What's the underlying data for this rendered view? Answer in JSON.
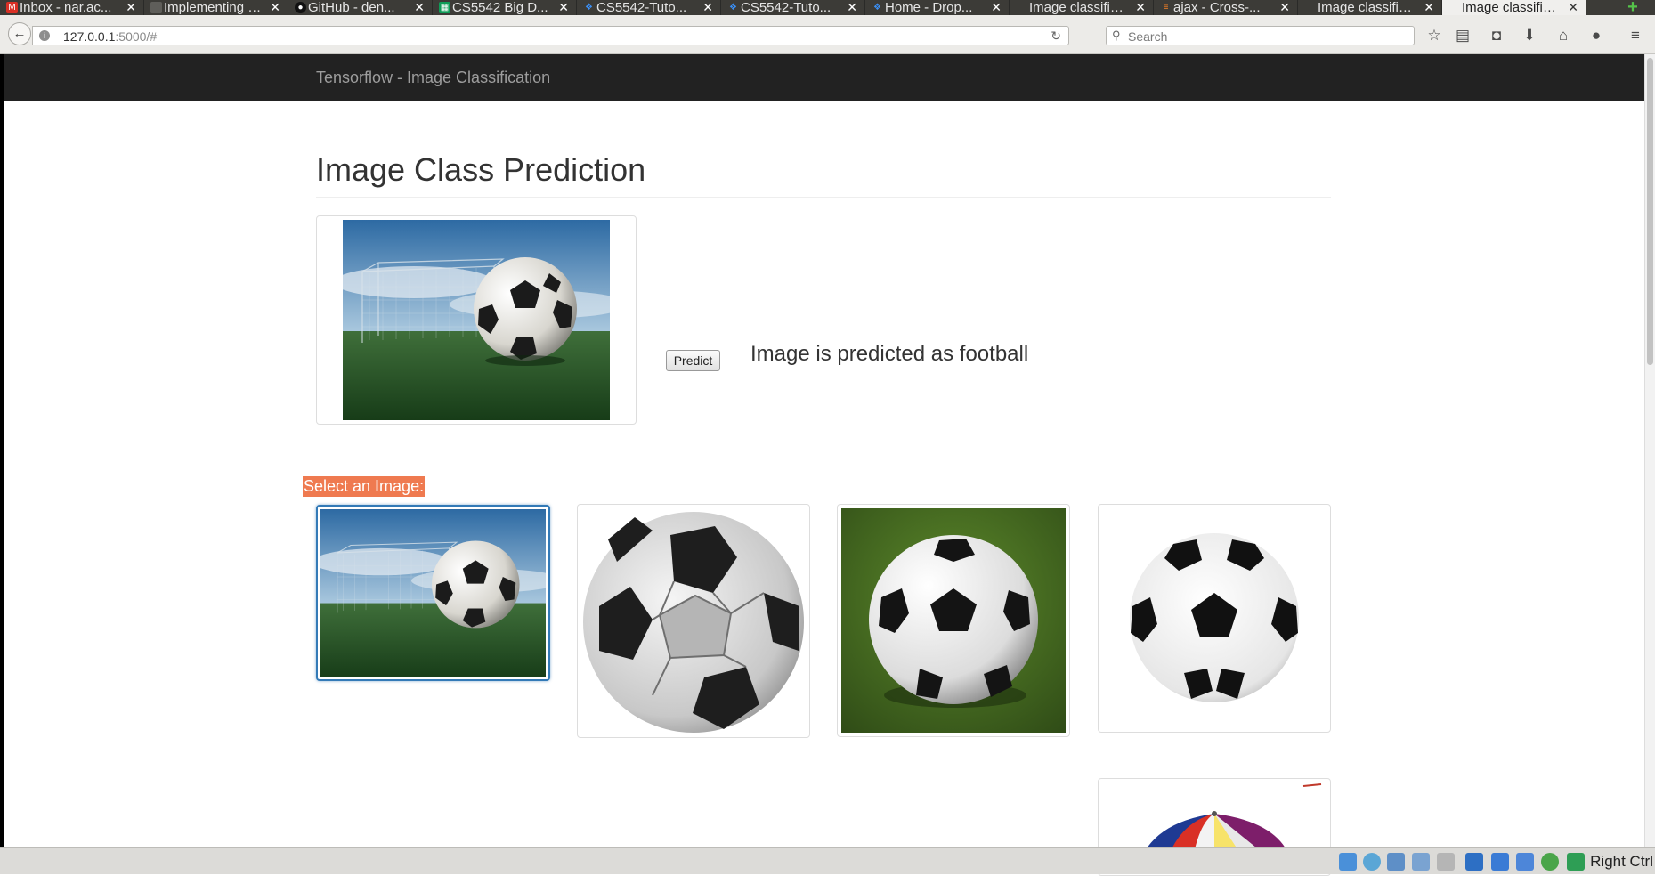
{
  "browser": {
    "tabs": [
      {
        "label": "Inbox - nar.ac...",
        "icon": "gmail-icon",
        "icon_color": "#d93025"
      },
      {
        "label": "Implementing a ...",
        "icon": "page-icon",
        "icon_color": "#3c3b37"
      },
      {
        "label": "GitHub - den...",
        "icon": "github-icon",
        "icon_color": "#000000"
      },
      {
        "label": "CS5542 Big D...",
        "icon": "sheets-icon",
        "icon_color": "#0f9d58"
      },
      {
        "label": "CS5542-Tuto...",
        "icon": "dropbox-icon",
        "icon_color": "#0061fe"
      },
      {
        "label": "CS5542-Tuto...",
        "icon": "dropbox-icon",
        "icon_color": "#0061fe"
      },
      {
        "label": "Home - Drop...",
        "icon": "dropbox-icon",
        "icon_color": "#0061fe"
      },
      {
        "label": "Image classifica...",
        "icon": "page-icon",
        "icon_color": "#3c3b37"
      },
      {
        "label": "ajax - Cross-...",
        "icon": "stackoverflow-icon",
        "icon_color": "#f48024"
      },
      {
        "label": "Image classifica...",
        "icon": "page-icon",
        "icon_color": "#3c3b37"
      },
      {
        "label": "Image classifica...",
        "icon": "page-icon",
        "icon_color": "#f0efed",
        "active": true
      }
    ],
    "url_host": "127.0.0.1",
    "url_path": ":5000/#",
    "search_placeholder": "Search"
  },
  "app": {
    "brand": "Tensorflow - Image Classification",
    "page_title": "Image Class Prediction",
    "predict_button": "Predict",
    "result_text": "Image is predicted as football",
    "select_label": "Select an Image:",
    "accent_color": "#ef7a50",
    "navbar_color": "#222222",
    "gallery": [
      {
        "name": "soccer-ball-goal-scene",
        "selected": true
      },
      {
        "name": "soccer-ball-closeup",
        "selected": false
      },
      {
        "name": "soccer-ball-on-grass",
        "selected": false
      },
      {
        "name": "soccer-ball-white-bg",
        "selected": false
      },
      {
        "name": "beach-ball",
        "selected": false
      }
    ]
  },
  "system_tray": {
    "host_key": "Right Ctrl"
  }
}
